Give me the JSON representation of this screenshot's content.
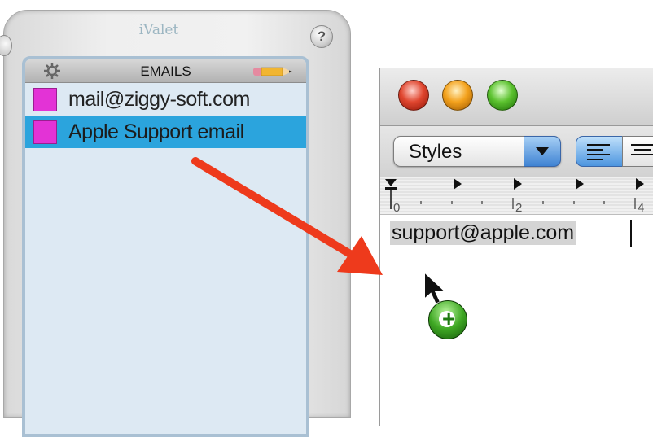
{
  "ivalet": {
    "title": "iValet",
    "help_label": "?",
    "panel_title": "EMAILS",
    "items": [
      {
        "label": "mail@ziggy-soft.com",
        "color": "#e333d6",
        "selected": false
      },
      {
        "label": "Apple Support email",
        "color": "#e333d6",
        "selected": true
      }
    ],
    "icons": [
      "gear-icon",
      "pencil-icon"
    ]
  },
  "text_window": {
    "toolbar": {
      "styles_label": "Styles",
      "align_left_icon": "align-left-icon",
      "align_center_icon": "align-center-icon"
    },
    "ruler": {
      "labels": [
        "0",
        "2",
        "4"
      ]
    },
    "document_text": "support@apple.com"
  },
  "overlay": {
    "arrow_color": "#ee3a1c",
    "cursor_icon": "arrow-cursor-icon",
    "badge_icon": "copy-plus-icon",
    "badge_symbol": "+"
  }
}
